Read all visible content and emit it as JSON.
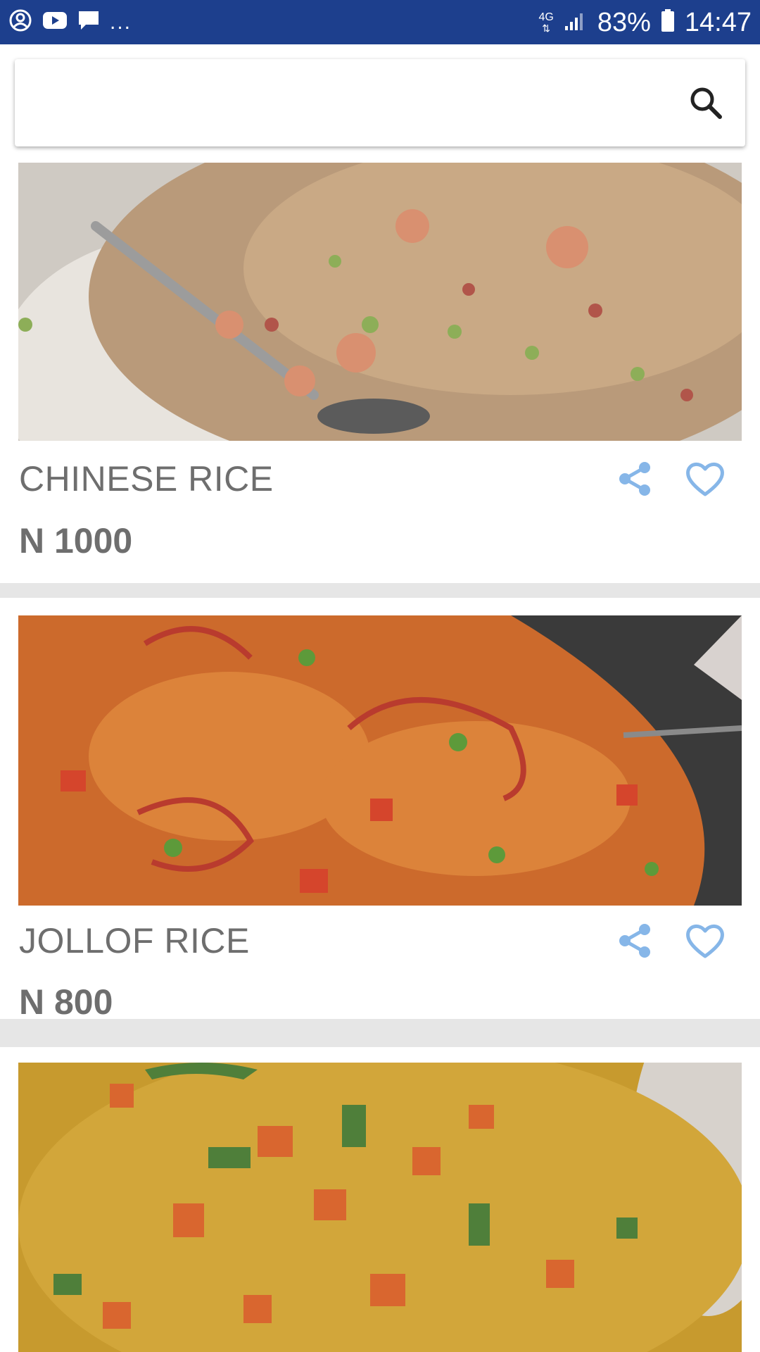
{
  "status_bar": {
    "more": "...",
    "network_type": "4G",
    "battery": "83%",
    "time": "14:47",
    "icons": [
      "account-circle-icon",
      "youtube-icon",
      "chat-bubble-icon",
      "network-4g-icon",
      "signal-icon",
      "battery-icon"
    ]
  },
  "search": {
    "placeholder": "",
    "value": "",
    "icon": "search-icon"
  },
  "colors": {
    "status_bar": "#1d3f8d",
    "action_icon": "#86b6e8",
    "text": "#6e6e6e",
    "divider": "#d9d9d9"
  },
  "items": [
    {
      "name": "CHINESE RICE",
      "price": "N 1000",
      "image": "chinese-fried-rice-with-shrimp",
      "share_icon": "share-icon",
      "favorite_icon": "heart-outline-icon"
    },
    {
      "name": "JOLLOF RICE",
      "price": "N 800",
      "image": "jollof-rice-in-pan",
      "share_icon": "share-icon",
      "favorite_icon": "heart-outline-icon"
    },
    {
      "name": "",
      "price": "",
      "image": "vegetable-fried-rice-with-carrots-and-peas"
    }
  ]
}
